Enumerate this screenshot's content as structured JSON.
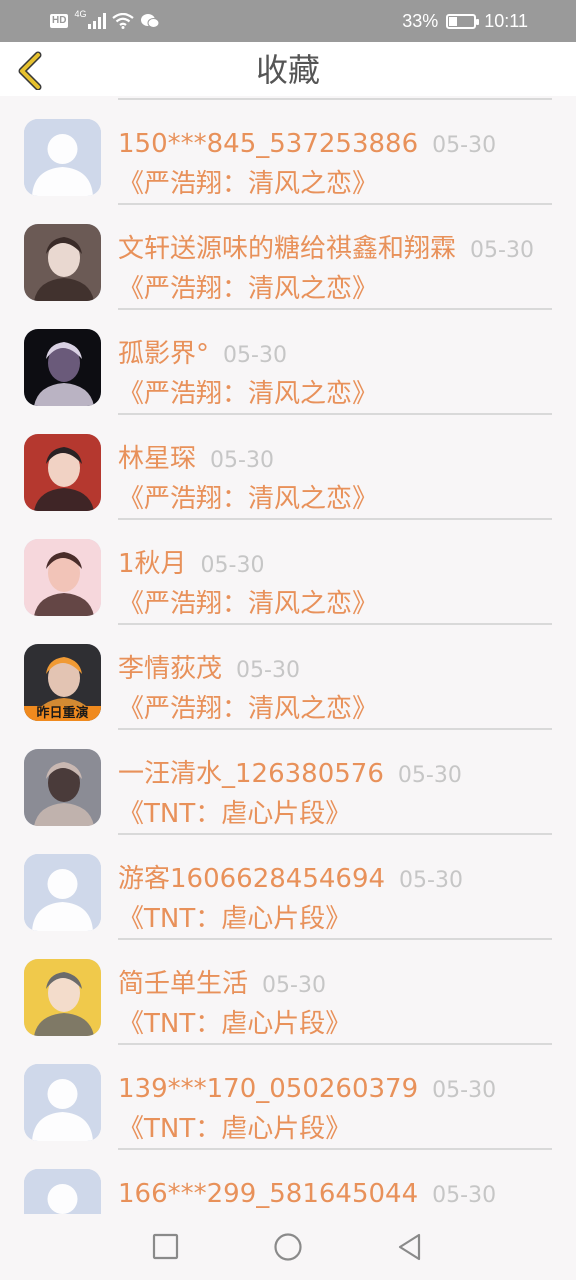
{
  "status_bar": {
    "hd": "HD",
    "network": "4G",
    "battery_percent": "33%",
    "battery_level": 0.33,
    "time": "10:11"
  },
  "header": {
    "title": "收藏",
    "back_icon": "chevron-left-icon",
    "accent_color": "#e6c12e"
  },
  "items": [
    {
      "name": "150***845_537253886",
      "date": "05-30",
      "work": "《严浩翔：清风之恋》",
      "avatar": "default"
    },
    {
      "name": "文轩送源味的糖给祺鑫和翔霖",
      "date": "05-30",
      "work": "《严浩翔：清风之恋》",
      "avatar": "photo"
    },
    {
      "name": "孤影界°",
      "date": "05-30",
      "work": "《严浩翔：清风之恋》",
      "avatar": "photo"
    },
    {
      "name": "林星琛",
      "date": "05-30",
      "work": "《严浩翔：清风之恋》",
      "avatar": "photo"
    },
    {
      "name": "1秋月",
      "date": "05-30",
      "work": "《严浩翔：清风之恋》",
      "avatar": "photo"
    },
    {
      "name": "李情荻茂",
      "date": "05-30",
      "work": "《严浩翔：清风之恋》",
      "avatar": "photo",
      "avatar_caption": "昨日重演"
    },
    {
      "name": "一汪清水_126380576",
      "date": "05-30",
      "work": "《TNT：虐心片段》",
      "avatar": "photo"
    },
    {
      "name": "游客1606628454694",
      "date": "05-30",
      "work": "《TNT：虐心片段》",
      "avatar": "default"
    },
    {
      "name": "简壬单生活",
      "date": "05-30",
      "work": "《TNT：虐心片段》",
      "avatar": "photo"
    },
    {
      "name": "139***170_050260379",
      "date": "05-30",
      "work": "《TNT：虐心片段》",
      "avatar": "default"
    },
    {
      "name": "166***299_581645044",
      "date": "05-30",
      "work": "",
      "avatar": "default"
    }
  ],
  "colors": {
    "name": "#e8915a",
    "date": "#c6c6c6",
    "divider": "#d9d9d9",
    "default_avatar_bg": "#cfd8ea"
  },
  "nav_bar": {
    "recent_icon": "square-icon",
    "home_icon": "circle-icon",
    "back_icon": "triangle-back-icon"
  }
}
